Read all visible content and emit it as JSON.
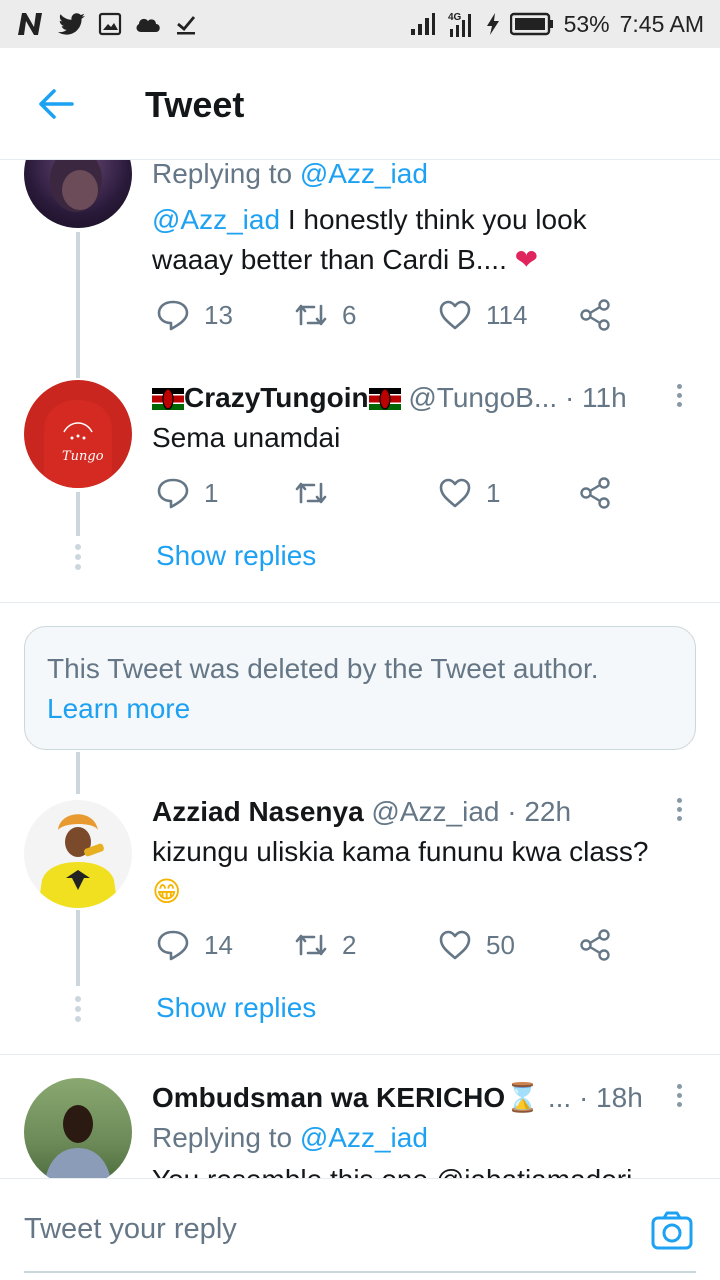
{
  "status": {
    "battery": "53%",
    "time": "7:45 AM",
    "network": "4G"
  },
  "header": {
    "title": "Tweet"
  },
  "tweets": [
    {
      "replying_prefix": "Replying to",
      "replying_handle": "@Azz_iad",
      "mention": "@Azz_iad",
      "text_line1": " I honestly think you look",
      "text_line2": "waaay better than Cardi B....",
      "emoji": "❤",
      "replies": "13",
      "retweets": "6",
      "likes": "114"
    },
    {
      "name": "CrazyTungoin",
      "handle": "@TungoB...",
      "time": "· 11h",
      "text": "Sema unamdai",
      "avatar_text": "Tungo",
      "replies": "1",
      "retweets": "",
      "likes": "1",
      "show_replies": "Show replies"
    },
    {
      "deleted_text": "This Tweet was deleted by the Tweet author.",
      "learn_more": "Learn more"
    },
    {
      "name": "Azziad Nasenya",
      "handle": "@Azz_iad",
      "time": "· 22h",
      "text": "kizungu uliskia kama fununu kwa class?",
      "emoji": "😁",
      "replies": "14",
      "retweets": "2",
      "likes": "50",
      "show_replies": "Show replies"
    },
    {
      "name": "Ombudsman wa KERICHO",
      "name_emoji": "⌛",
      "handle": "...",
      "time": "· 18h",
      "replying_prefix": "Replying to",
      "replying_handle": "@Azz_iad",
      "text_partial": "You resemble this one @jabatiamadori"
    }
  ],
  "reply_box": {
    "placeholder": "Tweet your reply"
  },
  "colors": {
    "accent": "#1da1f2",
    "text": "#14171a",
    "muted": "#657786",
    "like_pink": "#e0245e"
  }
}
